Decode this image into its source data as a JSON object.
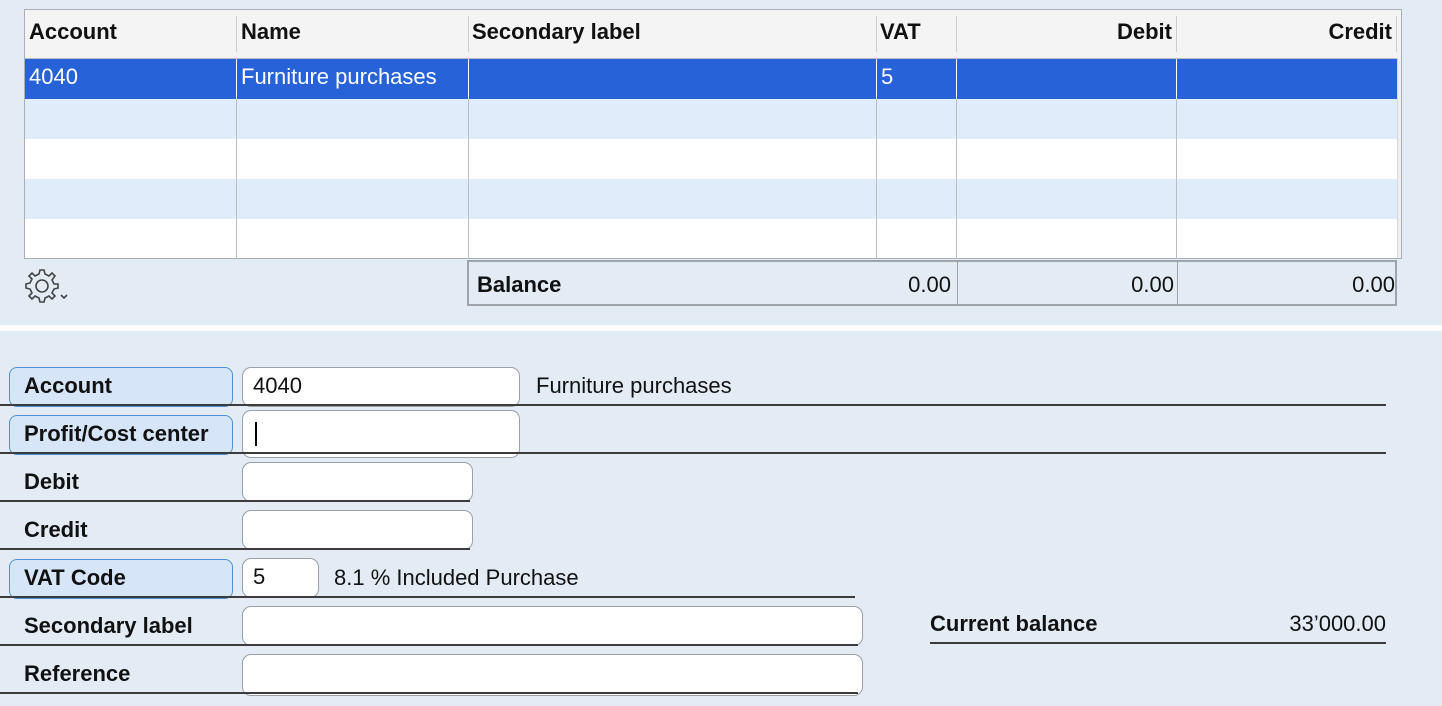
{
  "table": {
    "columns": [
      "Account",
      "Name",
      "Secondary label",
      "VAT",
      "Debit",
      "Credit"
    ],
    "rows": [
      {
        "account": "4040",
        "name": "Furniture purchases",
        "secondary_label": "",
        "vat": "5",
        "debit": "",
        "credit": "",
        "selected": true
      }
    ],
    "empty_rows": 4,
    "selection_color": "#2762d9",
    "alt_row_color": "#e1ecfb"
  },
  "settings_icon": "gear-icon",
  "balance": {
    "label": "Balance",
    "vat": "0.00",
    "debit": "0.00",
    "credit": "0.00"
  },
  "form": {
    "account": {
      "label": "Account",
      "value": "4040",
      "description": "Furniture purchases"
    },
    "profit_cost_center": {
      "label": "Profit/Cost center",
      "value": ""
    },
    "debit": {
      "label": "Debit",
      "value": ""
    },
    "credit": {
      "label": "Credit",
      "value": ""
    },
    "vat_code": {
      "label": "VAT Code",
      "value": "5",
      "description": "8.1 % Included Purchase"
    },
    "secondary_label": {
      "label": "Secondary label",
      "value": ""
    },
    "reference": {
      "label": "Reference",
      "value": ""
    },
    "current_balance": {
      "label": "Current balance",
      "value": "33’000.00"
    }
  },
  "colors": {
    "background": "#e3ecf5",
    "accent_border": "#4e90d6",
    "pill_fill": "#d6e6f8"
  }
}
